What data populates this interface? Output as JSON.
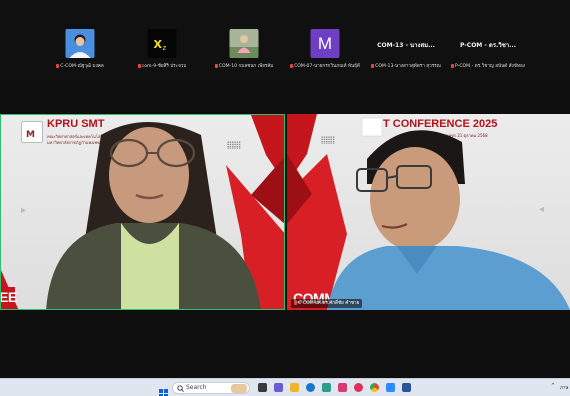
{
  "participants": [
    {
      "name": "C-COM-ณัฐวุฒิ มงคล",
      "thumb": "photo",
      "mic": "muted"
    },
    {
      "name": "com-9-ชัยสิริ ประจวบ",
      "thumb": "xz-logo",
      "mic": "muted"
    },
    {
      "name": "COM-10 กมลชนก เพียรส้ม",
      "thumb": "photo",
      "mic": "muted"
    },
    {
      "name": "COM-07-นายกรกวินภณห์ พันธุ์ดี",
      "thumb": "letter",
      "letter": "M",
      "mic": "muted"
    },
    {
      "name": "COM-13-นางสาวสุพัตรา สุวรรณ",
      "thumb": "text",
      "display": "COM-13 - นางสม...",
      "mic": "muted"
    },
    {
      "name": "P-COM - ดร.วิชาญ อนันต์ สังข์ทอง",
      "thumb": "text",
      "display": "P-COM - ดร.วิชา...",
      "mic": "muted"
    }
  ],
  "left_video": {
    "banner_title": "KPRU SMT",
    "banner_sub_1": "คณะวิทยาศาสตร์และเทคโนโลยี",
    "banner_sub_2": "มหาวิทยาลัยราชภัฏกำแพงเพชร",
    "bottom_text": "EE",
    "selected": true
  },
  "right_video": {
    "banner_title": "T CONFERENCE 2025",
    "banner_sub": "มหาวิทยาลัยราชภัฏกำแพงเพชร 21 ตุลาคม 2568",
    "bottom_text": "COMM",
    "name_label": "C-COM-ผศ.ดร.ศักดิ์ชัย คำชาย"
  },
  "taskbar": {
    "search_label": "Search",
    "tray_text": "ภาษ"
  },
  "colors": {
    "accent_red": "#c4161c",
    "active_border": "#2fbf71",
    "avatar_purple": "#6e3fc4"
  }
}
